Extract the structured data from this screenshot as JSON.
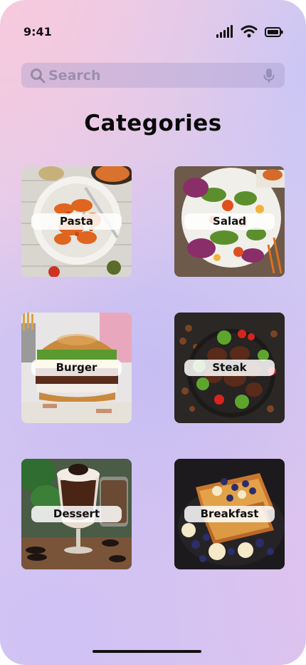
{
  "status": {
    "time": "9:41",
    "icons": [
      "cellular-signal-icon",
      "wifi-icon",
      "battery-icon"
    ]
  },
  "search": {
    "placeholder": "Search",
    "value": "",
    "icons": [
      "search-icon",
      "microphone-icon"
    ]
  },
  "page": {
    "title": "Categories"
  },
  "categories": [
    {
      "label": "Pasta"
    },
    {
      "label": "Salad"
    },
    {
      "label": "Burger"
    },
    {
      "label": "Steak"
    },
    {
      "label": "Dessert"
    },
    {
      "label": "Breakfast"
    }
  ],
  "colors": {
    "background_gradient": [
      "#f8c9dc",
      "#c8c6f6",
      "#d9c8f0"
    ],
    "title": "#0a0a0a",
    "label_bg": "#ffffff"
  }
}
